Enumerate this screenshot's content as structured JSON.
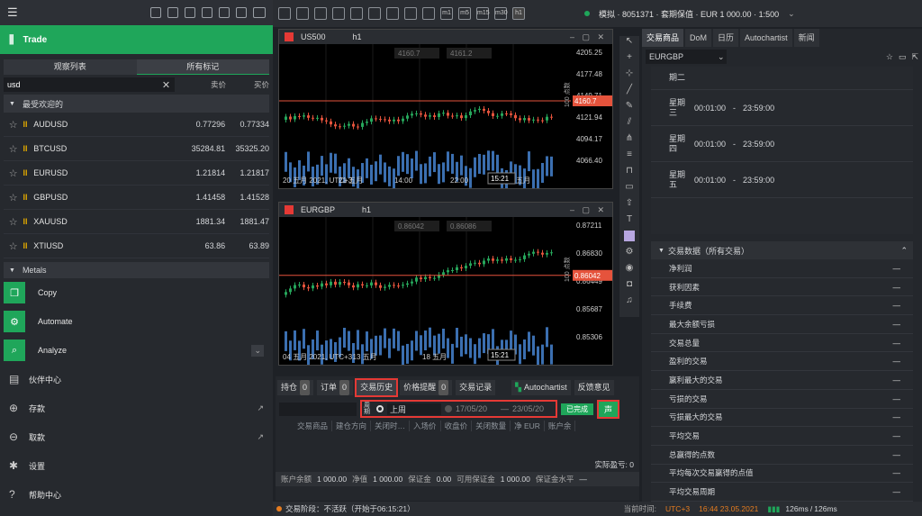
{
  "left": {
    "trade_label": "Trade",
    "tabs": [
      "观察列表",
      "所有标记"
    ],
    "search_value": "usd",
    "bid_header": "卖价",
    "ask_header": "买价",
    "favorites_label": "最受欢迎的",
    "symbols": [
      {
        "name": "AUDUSD",
        "bid": "0.77296",
        "ask": "0.77334"
      },
      {
        "name": "BTCUSD",
        "bid": "35284.81",
        "ask": "35325.20"
      },
      {
        "name": "EURUSD",
        "bid": "1.21814",
        "ask": "1.21817"
      },
      {
        "name": "GBPUSD",
        "bid": "1.41458",
        "ask": "1.41528"
      },
      {
        "name": "XAUUSD",
        "bid": "1881.34",
        "ask": "1881.47"
      },
      {
        "name": "XTIUSD",
        "bid": "63.86",
        "ask": "63.89"
      }
    ],
    "metals_label": "Metals",
    "menu": [
      {
        "label": "Copy",
        "icon": "copy-icon"
      },
      {
        "label": "Automate",
        "icon": "robot-icon"
      },
      {
        "label": "Analyze",
        "icon": "analyze-icon"
      }
    ],
    "menu2": [
      {
        "label": "伙伴中心",
        "icon": "briefcase-icon"
      },
      {
        "label": "存款",
        "icon": "deposit-icon"
      },
      {
        "label": "取款",
        "icon": "withdraw-icon"
      },
      {
        "label": "设置",
        "icon": "gear-icon"
      },
      {
        "label": "帮助中心",
        "icon": "help-icon"
      }
    ]
  },
  "toolbar": {
    "account": "模拟 · 8051371 · 套期保值 · EUR 1 000.00 · 1:500",
    "timeframes": [
      "m1",
      "m5",
      "m15",
      "m30",
      "h1"
    ]
  },
  "chart1": {
    "symbol": "US500",
    "tf": "h1",
    "bid_box": "4160.7",
    "ask_box": "4161.2",
    "scale_label": "100 点数",
    "price_labels": [
      "4205.25",
      "4177.48",
      "4149.71",
      "4121.94",
      "4094.17",
      "4066.40"
    ],
    "current_price": "4160.7",
    "time_labels": [
      "20 五月 2021, UTC+3",
      "21 五月",
      "14:00",
      "22:00",
      "22 五月"
    ],
    "cursor_time": "15:21"
  },
  "chart2": {
    "symbol": "EURGBP",
    "tf": "h1",
    "bid_box": "0.86042",
    "ask_box": "0.86086",
    "scale_label": "100 点数",
    "price_labels": [
      "0.87211",
      "0.86830",
      "0.86449",
      "0.85687",
      "0.85306"
    ],
    "current_price": "0.86042",
    "time_labels": [
      "04 五月 2021, UTC+3",
      "13 五月",
      "18 五月",
      "20 五月"
    ],
    "cursor_time": "15:21"
  },
  "bottom": {
    "tabs": [
      {
        "label": "持仓",
        "count": "0"
      },
      {
        "label": "订单",
        "count": "0"
      },
      {
        "label": "交易历史",
        "count": ""
      },
      {
        "label": "价格提醒",
        "count": "0"
      },
      {
        "label": "交易记录",
        "count": ""
      }
    ],
    "autochartist": "Autochartist",
    "feedback": "反馈意见",
    "period_label": "周期",
    "period_value": "上周",
    "date_from": "17/05/20",
    "date_to": "23/05/20",
    "done_label": "已完成",
    "export_label": "声",
    "columns": [
      "交易商品",
      "建仓方向",
      "关闭时…",
      "入场价",
      "收盘价",
      "关闭数量",
      "净 EUR",
      "账户余"
    ],
    "realized": "实际盈亏: 0",
    "balance_items": [
      {
        "k": "账户余额",
        "v": "1 000.00"
      },
      {
        "k": "净值",
        "v": "1 000.00"
      },
      {
        "k": "保证金",
        "v": "0.00"
      },
      {
        "k": "可用保证金",
        "v": "1 000.00"
      },
      {
        "k": "保证金水平",
        "v": "—"
      }
    ]
  },
  "right": {
    "tabs": [
      "交易商品",
      "DoM",
      "日历",
      "Autochartist",
      "新闻"
    ],
    "symbol_select": "EURGBP",
    "schedule": [
      {
        "day": "期二",
        "from": "",
        "to": ""
      },
      {
        "day": "星期三",
        "from": "00:01:00",
        "to": "23:59:00"
      },
      {
        "day": "星期四",
        "from": "00:01:00",
        "to": "23:59:00"
      },
      {
        "day": "星期五",
        "from": "00:01:00",
        "to": "23:59:00"
      }
    ],
    "stats_title": "交易数据（所有交易）",
    "stats": [
      {
        "k": "净利润",
        "v": "—"
      },
      {
        "k": "获利因素",
        "v": "—"
      },
      {
        "k": "手续费",
        "v": "—"
      },
      {
        "k": "最大余额亏损",
        "v": "—"
      },
      {
        "k": "交易总量",
        "v": "—"
      },
      {
        "k": "盈利的交易",
        "v": "—"
      },
      {
        "k": "赢利最大的交易",
        "v": "—"
      },
      {
        "k": "亏损的交易",
        "v": "—"
      },
      {
        "k": "亏损最大的交易",
        "v": "—"
      },
      {
        "k": "平均交易",
        "v": "—"
      },
      {
        "k": "总赢得的点数",
        "v": "—"
      },
      {
        "k": "平均每次交易赢得的点值",
        "v": "—"
      },
      {
        "k": "平均交易周期",
        "v": "—"
      }
    ]
  },
  "status": {
    "session": "交易阶段：不活跃（开始于06:15:21）",
    "server_time_label": "当前时间:",
    "tz": "UTC+3",
    "time": "16:44 23.05.2021",
    "latency1": "126ms",
    "latency2": "126ms"
  }
}
